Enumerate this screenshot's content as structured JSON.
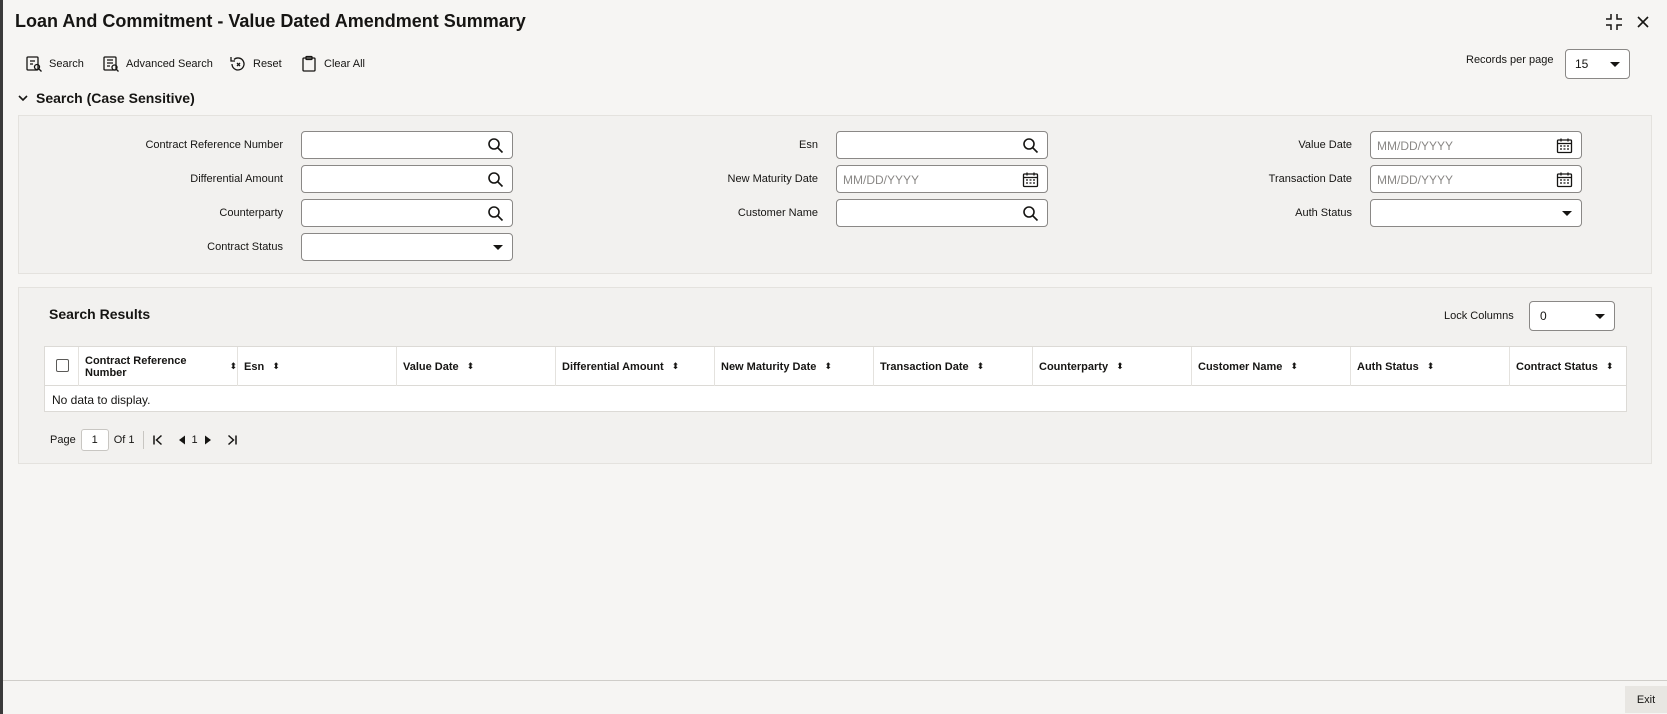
{
  "window": {
    "title": "Loan And Commitment - Value Dated Amendment Summary"
  },
  "toolbar": {
    "search": "Search",
    "advanced_search": "Advanced Search",
    "reset": "Reset",
    "clear_all": "Clear All",
    "records_per_page_label": "Records per page",
    "records_per_page_value": "15"
  },
  "search_section": {
    "title": "Search (Case Sensitive)",
    "fields": {
      "contract_reference_number": {
        "label": "Contract Reference Number",
        "value": ""
      },
      "differential_amount": {
        "label": "Differential Amount",
        "value": ""
      },
      "counterparty": {
        "label": "Counterparty",
        "value": ""
      },
      "contract_status": {
        "label": "Contract Status",
        "value": ""
      },
      "esn": {
        "label": "Esn",
        "value": ""
      },
      "new_maturity_date": {
        "label": "New Maturity Date",
        "placeholder": "MM/DD/YYYY"
      },
      "customer_name": {
        "label": "Customer Name",
        "value": ""
      },
      "value_date": {
        "label": "Value Date",
        "placeholder": "MM/DD/YYYY"
      },
      "transaction_date": {
        "label": "Transaction Date",
        "placeholder": "MM/DD/YYYY"
      },
      "auth_status": {
        "label": "Auth Status",
        "value": ""
      }
    }
  },
  "results": {
    "title": "Search Results",
    "lock_columns_label": "Lock Columns",
    "lock_columns_value": "0",
    "columns": [
      "Contract Reference Number",
      "Esn",
      "Value Date",
      "Differential Amount",
      "New Maturity Date",
      "Transaction Date",
      "Counterparty",
      "Customer Name",
      "Auth Status",
      "Contract Status"
    ],
    "empty_text": "No data to display.",
    "pager": {
      "page_label": "Page",
      "page_value": "1",
      "of_label": "Of 1",
      "current": "1"
    }
  },
  "footer": {
    "exit": "Exit"
  }
}
